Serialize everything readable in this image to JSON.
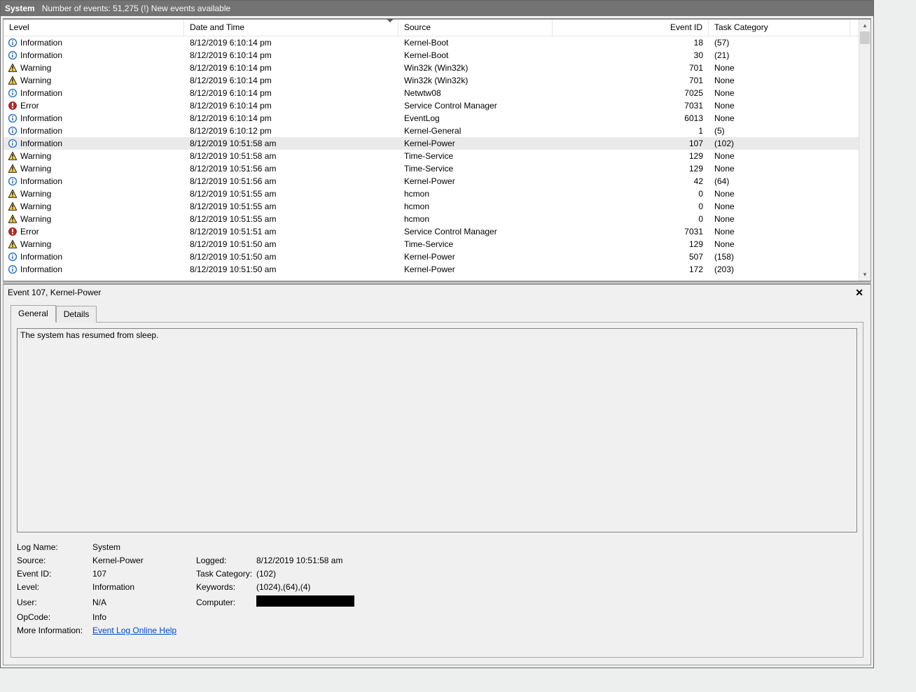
{
  "titlebar": {
    "log_name": "System",
    "subtitle": "Number of events: 51,275 (!) New events available"
  },
  "columns": {
    "level": "Level",
    "date": "Date and Time",
    "source": "Source",
    "event_id": "Event ID",
    "task_category": "Task Category"
  },
  "levels": {
    "info": "Information",
    "warn": "Warning",
    "err": "Error"
  },
  "events": [
    {
      "level": "info",
      "date": "8/12/2019 6:10:14 pm",
      "source": "Kernel-Boot",
      "id": "18",
      "cat": "(57)",
      "selected": false
    },
    {
      "level": "info",
      "date": "8/12/2019 6:10:14 pm",
      "source": "Kernel-Boot",
      "id": "30",
      "cat": "(21)",
      "selected": false
    },
    {
      "level": "warn",
      "date": "8/12/2019 6:10:14 pm",
      "source": "Win32k (Win32k)",
      "id": "701",
      "cat": "None",
      "selected": false
    },
    {
      "level": "warn",
      "date": "8/12/2019 6:10:14 pm",
      "source": "Win32k (Win32k)",
      "id": "701",
      "cat": "None",
      "selected": false
    },
    {
      "level": "info",
      "date": "8/12/2019 6:10:14 pm",
      "source": "Netwtw08",
      "id": "7025",
      "cat": "None",
      "selected": false
    },
    {
      "level": "err",
      "date": "8/12/2019 6:10:14 pm",
      "source": "Service Control Manager",
      "id": "7031",
      "cat": "None",
      "selected": false
    },
    {
      "level": "info",
      "date": "8/12/2019 6:10:14 pm",
      "source": "EventLog",
      "id": "6013",
      "cat": "None",
      "selected": false
    },
    {
      "level": "info",
      "date": "8/12/2019 6:10:12 pm",
      "source": "Kernel-General",
      "id": "1",
      "cat": "(5)",
      "selected": false
    },
    {
      "level": "info",
      "date": "8/12/2019 10:51:58 am",
      "source": "Kernel-Power",
      "id": "107",
      "cat": "(102)",
      "selected": true
    },
    {
      "level": "warn",
      "date": "8/12/2019 10:51:58 am",
      "source": "Time-Service",
      "id": "129",
      "cat": "None",
      "selected": false
    },
    {
      "level": "warn",
      "date": "8/12/2019 10:51:56 am",
      "source": "Time-Service",
      "id": "129",
      "cat": "None",
      "selected": false
    },
    {
      "level": "info",
      "date": "8/12/2019 10:51:56 am",
      "source": "Kernel-Power",
      "id": "42",
      "cat": "(64)",
      "selected": false
    },
    {
      "level": "warn",
      "date": "8/12/2019 10:51:55 am",
      "source": "hcmon",
      "id": "0",
      "cat": "None",
      "selected": false
    },
    {
      "level": "warn",
      "date": "8/12/2019 10:51:55 am",
      "source": "hcmon",
      "id": "0",
      "cat": "None",
      "selected": false
    },
    {
      "level": "warn",
      "date": "8/12/2019 10:51:55 am",
      "source": "hcmon",
      "id": "0",
      "cat": "None",
      "selected": false
    },
    {
      "level": "err",
      "date": "8/12/2019 10:51:51 am",
      "source": "Service Control Manager",
      "id": "7031",
      "cat": "None",
      "selected": false
    },
    {
      "level": "warn",
      "date": "8/12/2019 10:51:50 am",
      "source": "Time-Service",
      "id": "129",
      "cat": "None",
      "selected": false
    },
    {
      "level": "info",
      "date": "8/12/2019 10:51:50 am",
      "source": "Kernel-Power",
      "id": "507",
      "cat": "(158)",
      "selected": false
    },
    {
      "level": "info",
      "date": "8/12/2019 10:51:50 am",
      "source": "Kernel-Power",
      "id": "172",
      "cat": "(203)",
      "selected": false
    }
  ],
  "detail": {
    "header": "Event 107, Kernel-Power",
    "tabs": {
      "general": "General",
      "details": "Details"
    },
    "description": "The system has resumed from sleep.",
    "labels": {
      "log_name": "Log Name:",
      "source": "Source:",
      "event_id": "Event ID:",
      "level": "Level:",
      "user": "User:",
      "opcode": "OpCode:",
      "more_info": "More Information:",
      "logged": "Logged:",
      "task_category": "Task Category:",
      "keywords": "Keywords:",
      "computer": "Computer:"
    },
    "values": {
      "log_name": "System",
      "source": "Kernel-Power",
      "event_id": "107",
      "level": "Information",
      "user": "N/A",
      "opcode": "Info",
      "logged": "8/12/2019 10:51:58 am",
      "task_category": "(102)",
      "keywords": "(1024),(64),(4)",
      "help_link": "Event Log Online Help"
    }
  }
}
